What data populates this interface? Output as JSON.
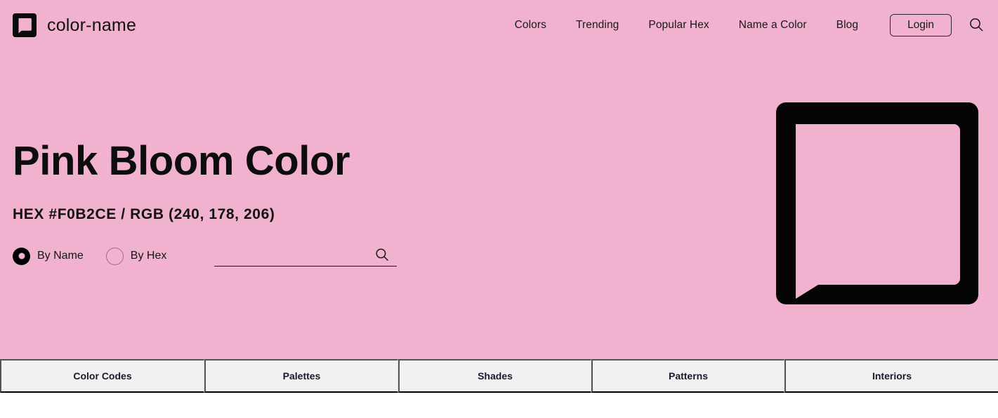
{
  "brand": {
    "name": "color-name",
    "logo_icon": "speech-bubble-square-icon"
  },
  "nav": {
    "links": [
      {
        "label": "Colors"
      },
      {
        "label": "Trending"
      },
      {
        "label": "Popular Hex"
      },
      {
        "label": "Name a Color"
      },
      {
        "label": "Blog"
      }
    ],
    "login_label": "Login",
    "search_icon": "search-icon"
  },
  "hero": {
    "title": "Pink Bloom Color",
    "subtitle": "HEX #F0B2CE / RGB (240, 178, 206)",
    "hex": "#F0B2CE",
    "rgb": "(240, 178, 206)",
    "swatch_color": "#F0B2CE",
    "swatch_icon": "speech-bubble-swatch-icon",
    "background_color": "#F0B2CE",
    "search": {
      "options": [
        {
          "label": "By Name",
          "selected": true
        },
        {
          "label": "By Hex",
          "selected": false
        }
      ],
      "value": "",
      "placeholder": "",
      "icon": "search-icon"
    }
  },
  "tabs": [
    {
      "label": "Color Codes"
    },
    {
      "label": "Palettes"
    },
    {
      "label": "Shades"
    },
    {
      "label": "Patterns"
    },
    {
      "label": "Interiors"
    }
  ]
}
